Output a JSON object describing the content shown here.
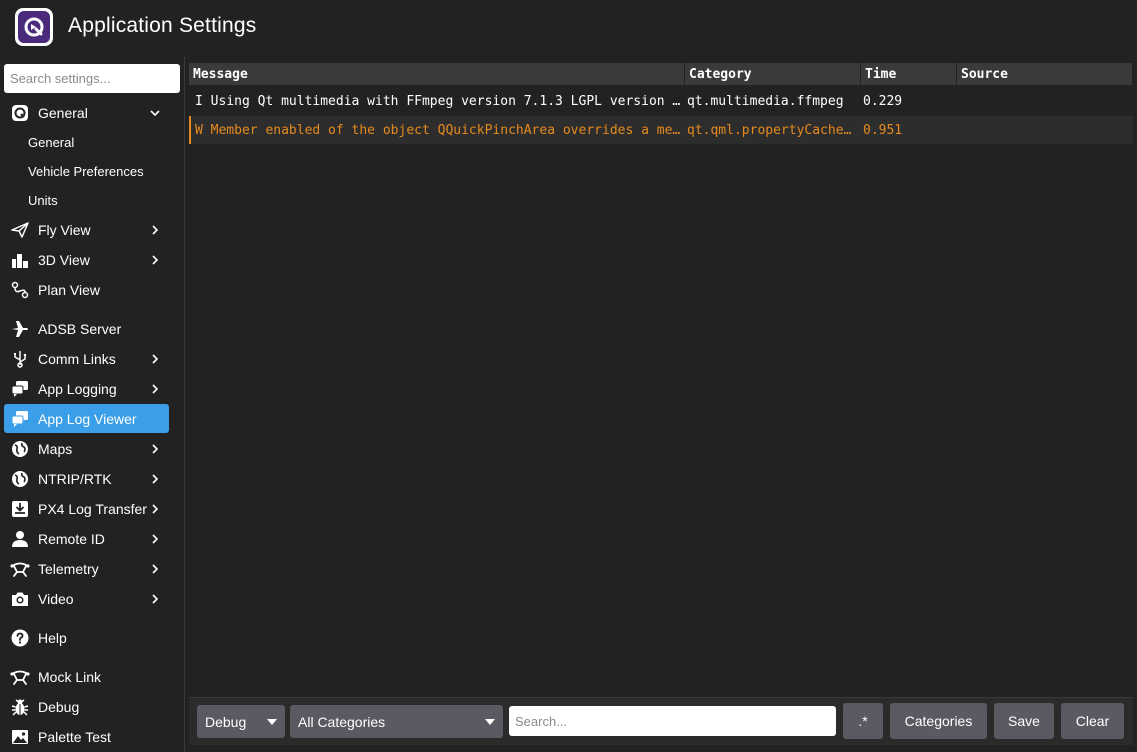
{
  "app": {
    "title": "Application Settings",
    "logo_icon": "qgc-logo-icon"
  },
  "sidebar": {
    "search_placeholder": "Search settings...",
    "items": [
      {
        "label": "General",
        "icon": "qgc-small-icon",
        "chevron": "down"
      },
      {
        "label": "Fly View",
        "icon": "paper-plane-icon",
        "chevron": "right"
      },
      {
        "label": "3D View",
        "icon": "buildings-icon",
        "chevron": "right"
      },
      {
        "label": "Plan View",
        "icon": "route-icon",
        "chevron": ""
      },
      {
        "label": "ADSB Server",
        "icon": "airplane-icon",
        "chevron": ""
      },
      {
        "label": "Comm Links",
        "icon": "usb-icon",
        "chevron": "right"
      },
      {
        "label": "App Logging",
        "icon": "chat-icon",
        "chevron": "right"
      },
      {
        "label": "App Log Viewer",
        "icon": "chat-icon",
        "chevron": ""
      },
      {
        "label": "Maps",
        "icon": "globe-icon",
        "chevron": "right"
      },
      {
        "label": "NTRIP/RTK",
        "icon": "globe-icon",
        "chevron": "right"
      },
      {
        "label": "PX4 Log Transfer",
        "icon": "download-box-icon",
        "chevron": "right"
      },
      {
        "label": "Remote ID",
        "icon": "person-icon",
        "chevron": "right"
      },
      {
        "label": "Telemetry",
        "icon": "drone-icon",
        "chevron": "right"
      },
      {
        "label": "Video",
        "icon": "camera-icon",
        "chevron": "right"
      },
      {
        "label": "Help",
        "icon": "help-icon",
        "chevron": ""
      },
      {
        "label": "Mock Link",
        "icon": "drone-icon",
        "chevron": ""
      },
      {
        "label": "Debug",
        "icon": "bug-icon",
        "chevron": ""
      },
      {
        "label": "Palette Test",
        "icon": "image-icon",
        "chevron": ""
      }
    ],
    "general_subitems": [
      "General",
      "Vehicle Preferences",
      "Units"
    ],
    "active_item": "App Log Viewer"
  },
  "log_table": {
    "columns": [
      "Message",
      "Category",
      "Time",
      "Source"
    ],
    "rows": [
      {
        "level": "info",
        "message": "I Using Qt multimedia with FFmpeg version 7.1.3 LGPL version …",
        "category": "qt.multimedia.ffmpeg",
        "time": "0.229",
        "source": ""
      },
      {
        "level": "warning",
        "message": "W Member enabled of the object QQuickPinchArea overrides a me…",
        "category": "qt.qml.propertyCache…",
        "time": "0.951",
        "source": ""
      }
    ]
  },
  "toolbar": {
    "level_select": "Debug",
    "category_select": "All Categories",
    "search_placeholder": "Search...",
    "regex_label": ".*",
    "categories_label": "Categories",
    "save_label": "Save",
    "clear_label": "Clear"
  },
  "colors": {
    "accent": "#3a9fe8",
    "warning": "#e58a1e",
    "background": "#222222",
    "button": "#5a5a62"
  }
}
